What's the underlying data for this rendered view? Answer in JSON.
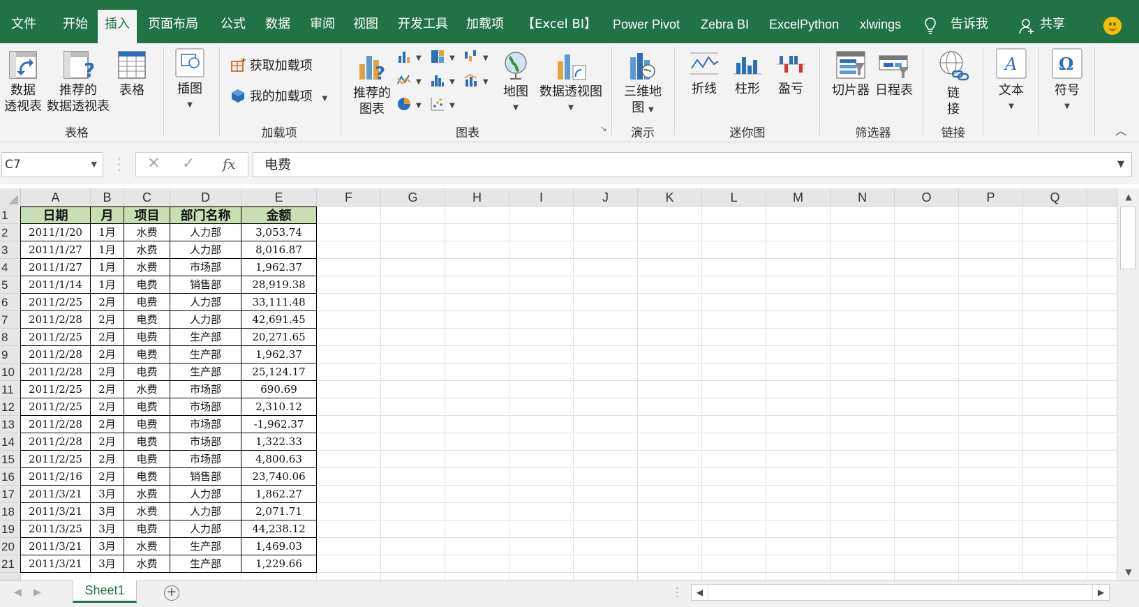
{
  "menu": {
    "tabs": [
      "文件",
      "开始",
      "插入",
      "页面布局",
      "公式",
      "数据",
      "审阅",
      "视图",
      "开发工具",
      "加载项",
      "【Excel BI】",
      "Power Pivot",
      "Zebra BI",
      "ExcelPython",
      "xlwings"
    ],
    "active_tab": "插入",
    "tell_me": "告诉我",
    "share": "共享"
  },
  "ribbon": {
    "groups": {
      "tables": "表格",
      "addins": "加载项",
      "charts": "图表",
      "tours": "演示",
      "sparklines": "迷你图",
      "filters": "筛选器",
      "links": "链接"
    },
    "buttons": {
      "pivot_table_1": "数据",
      "pivot_table_2": "透视表",
      "rec_pivot_1": "推荐的",
      "rec_pivot_2": "数据透视表",
      "table": "表格",
      "illustrations": "插图",
      "get_addins": "获取加载项",
      "my_addins": "我的加载项",
      "rec_charts_1": "推荐的",
      "rec_charts_2": "图表",
      "maps": "地图",
      "pivot_chart": "数据透视图",
      "map3d_1": "三维地",
      "map3d_2": "图",
      "line": "折线",
      "column": "柱形",
      "winloss": "盈亏",
      "slicer": "切片器",
      "timeline": "日程表",
      "link_1": "链",
      "link_2": "接",
      "text": "文本",
      "symbol": "符号"
    }
  },
  "formula_bar": {
    "name_box": "C7",
    "formula": "电费",
    "fx": "fx"
  },
  "grid": {
    "columns": [
      "A",
      "B",
      "C",
      "D",
      "E",
      "F",
      "G",
      "H",
      "I",
      "J",
      "K",
      "L",
      "M",
      "N",
      "O",
      "P",
      "Q"
    ],
    "rows": [
      "1",
      "2",
      "3",
      "4",
      "5",
      "6",
      "7",
      "8",
      "9",
      "10",
      "11",
      "12",
      "13",
      "14",
      "15",
      "16",
      "17",
      "18",
      "19",
      "20",
      "21"
    ],
    "headers": [
      "日期",
      "月",
      "项目",
      "部门名称",
      "金额"
    ],
    "data": [
      [
        "2011/1/20",
        "1月",
        "水费",
        "人力部",
        "3,053.74"
      ],
      [
        "2011/1/27",
        "1月",
        "水费",
        "人力部",
        "8,016.87"
      ],
      [
        "2011/1/27",
        "1月",
        "水费",
        "市场部",
        "1,962.37"
      ],
      [
        "2011/1/14",
        "1月",
        "电费",
        "销售部",
        "28,919.38"
      ],
      [
        "2011/2/25",
        "2月",
        "电费",
        "人力部",
        "33,111.48"
      ],
      [
        "2011/2/28",
        "2月",
        "电费",
        "人力部",
        "42,691.45"
      ],
      [
        "2011/2/25",
        "2月",
        "电费",
        "生产部",
        "20,271.65"
      ],
      [
        "2011/2/28",
        "2月",
        "电费",
        "生产部",
        "1,962.37"
      ],
      [
        "2011/2/28",
        "2月",
        "电费",
        "生产部",
        "25,124.17"
      ],
      [
        "2011/2/25",
        "2月",
        "水费",
        "市场部",
        "690.69"
      ],
      [
        "2011/2/25",
        "2月",
        "电费",
        "市场部",
        "2,310.12"
      ],
      [
        "2011/2/28",
        "2月",
        "电费",
        "市场部",
        "-1,962.37"
      ],
      [
        "2011/2/28",
        "2月",
        "电费",
        "市场部",
        "1,322.33"
      ],
      [
        "2011/2/25",
        "2月",
        "电费",
        "市场部",
        "4,800.63"
      ],
      [
        "2011/2/16",
        "2月",
        "电费",
        "销售部",
        "23,740.06"
      ],
      [
        "2011/3/21",
        "3月",
        "水费",
        "人力部",
        "1,862.27"
      ],
      [
        "2011/3/21",
        "3月",
        "水费",
        "人力部",
        "2,071.71"
      ],
      [
        "2011/3/25",
        "3月",
        "电费",
        "人力部",
        "44,238.12"
      ],
      [
        "2011/3/21",
        "3月",
        "水费",
        "生产部",
        "1,469.03"
      ],
      [
        "2011/3/21",
        "3月",
        "水费",
        "生产部",
        "1,229.66"
      ]
    ]
  },
  "sheet_tabs": {
    "sheets": [
      "Sheet1"
    ],
    "add_label": "+"
  },
  "colors": {
    "excel_green": "#217346",
    "header_fill": "#c6e0b4"
  },
  "icons": [
    "pivot-table-icon",
    "recommended-pivot-icon",
    "table-icon",
    "illustrations-icon",
    "store-icon",
    "my-addins-icon",
    "recommended-charts-icon",
    "map-globe-icon",
    "pivot-chart-icon",
    "3d-map-icon",
    "sparkline-line-icon",
    "sparkline-column-icon",
    "sparkline-winloss-icon",
    "slicer-icon",
    "timeline-icon",
    "link-icon",
    "text-icon",
    "symbol-icon",
    "lightbulb-icon",
    "share-user-icon",
    "smiley-icon"
  ]
}
